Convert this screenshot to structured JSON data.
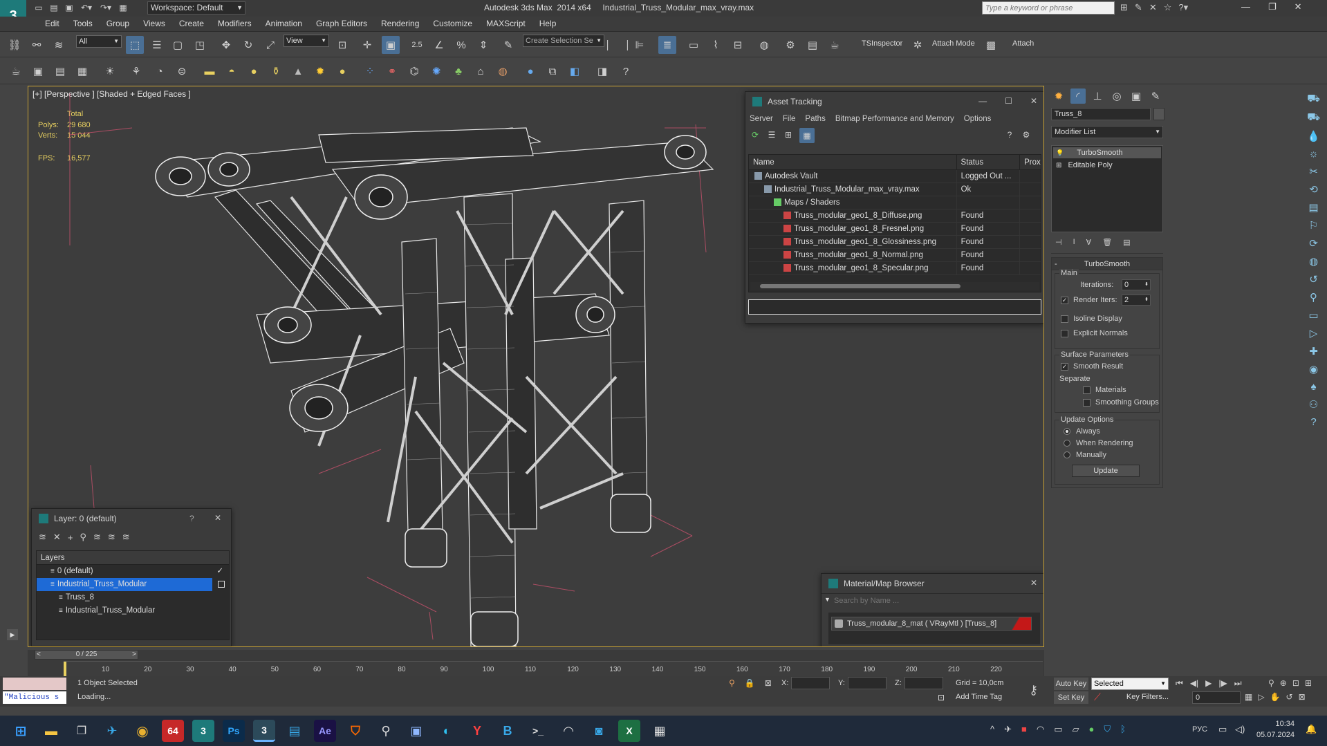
{
  "titlebar": {
    "quick_access": [
      "new-file-icon",
      "open-folder-icon",
      "save-icon",
      "undo-icon",
      "redo-icon",
      "project-icon"
    ],
    "workspace": "Workspace: Default",
    "app_title": "Autodesk 3ds Max  2014 x64     Industrial_Truss_Modular_max_vray.max",
    "search_placeholder": "Type a keyword or phrase"
  },
  "menu": [
    "Edit",
    "Tools",
    "Group",
    "Views",
    "Create",
    "Modifiers",
    "Animation",
    "Graph Editors",
    "Rendering",
    "Customize",
    "MAXScript",
    "Help"
  ],
  "toolbar1": {
    "filter_value": "All",
    "ref_coord": "View",
    "selection_set_placeholder": "Create Selection Se",
    "snap_label": "2.5",
    "ts_inspector": "TSInspector",
    "attach_mode": "Attach Mode",
    "attach": "Attach"
  },
  "viewport": {
    "label": "[+] [Perspective ] [Shaded + Edged Faces ]",
    "stats": {
      "total": "Total",
      "polys_label": "Polys:",
      "polys": "29 680",
      "verts_label": "Verts:",
      "verts": "15 044",
      "fps_label": "FPS:",
      "fps": "16,577"
    }
  },
  "asset_tracking": {
    "title": "Asset Tracking",
    "menu": [
      "Server",
      "File",
      "Paths",
      "Bitmap Performance and Memory",
      "Options"
    ],
    "columns": [
      "Name",
      "Status",
      "Prox"
    ],
    "rows": [
      {
        "name": "Autodesk Vault",
        "status": "Logged Out ...",
        "indent": 0,
        "icon": "vault-icon"
      },
      {
        "name": "Industrial_Truss_Modular_max_vray.max",
        "status": "Ok",
        "indent": 1,
        "icon": "max-file-icon"
      },
      {
        "name": "Maps / Shaders",
        "status": "",
        "indent": 2,
        "icon": "maps-folder-icon"
      },
      {
        "name": "Truss_modular_geo1_8_Diffuse.png",
        "status": "Found",
        "indent": 3,
        "icon": "png-icon"
      },
      {
        "name": "Truss_modular_geo1_8_Fresnel.png",
        "status": "Found",
        "indent": 3,
        "icon": "png-icon"
      },
      {
        "name": "Truss_modular_geo1_8_Glossiness.png",
        "status": "Found",
        "indent": 3,
        "icon": "png-icon"
      },
      {
        "name": "Truss_modular_geo1_8_Normal.png",
        "status": "Found",
        "indent": 3,
        "icon": "png-icon"
      },
      {
        "name": "Truss_modular_geo1_8_Specular.png",
        "status": "Found",
        "indent": 3,
        "icon": "png-icon"
      }
    ]
  },
  "layer_panel": {
    "title": "Layer: 0 (default)",
    "help": "?",
    "header": "Layers",
    "rows": [
      {
        "name": "0 (default)",
        "indent": 1,
        "selected": false,
        "check": true
      },
      {
        "name": "Industrial_Truss_Modular",
        "indent": 1,
        "selected": true,
        "check": false
      },
      {
        "name": "Truss_8",
        "indent": 2,
        "selected": false,
        "check": false
      },
      {
        "name": "Industrial_Truss_Modular",
        "indent": 2,
        "selected": false,
        "check": false
      }
    ]
  },
  "material_browser": {
    "title": "Material/Map Browser",
    "search_placeholder": "Search by Name ...",
    "item": "Truss_modular_8_mat  ( VRayMtl )  [Truss_8]"
  },
  "command_panel": {
    "object_name": "Truss_8",
    "modifier_list": "Modifier List",
    "stack": [
      "TurboSmooth",
      "Editable Poly"
    ],
    "rollout_title": "TurboSmooth",
    "main_label": "Main",
    "iterations_label": "Iterations:",
    "iterations": "0",
    "render_iters_label": "Render Iters:",
    "render_iters": "2",
    "isoline": "Isoline Display",
    "explicit": "Explicit Normals",
    "surface_params": "Surface Parameters",
    "smooth_result": "Smooth Result",
    "separate": "Separate",
    "materials": "Materials",
    "smoothing_groups": "Smoothing Groups",
    "update_options": "Update Options",
    "always": "Always",
    "when_rendering": "When Rendering",
    "manually": "Manually",
    "update_btn": "Update"
  },
  "timeline": {
    "frame": "0 / 225",
    "ticks": [
      "10",
      "20",
      "30",
      "40",
      "50",
      "60",
      "70",
      "80",
      "90",
      "100",
      "110",
      "120",
      "130",
      "140",
      "150",
      "160",
      "170",
      "180",
      "190",
      "200",
      "210",
      "220"
    ]
  },
  "status": {
    "selected": "1 Object Selected",
    "loading": "Loading...",
    "maxscript": "\"Malicious s",
    "x_label": "X:",
    "y_label": "Y:",
    "z_label": "Z:",
    "grid": "Grid = 10,0cm",
    "add_time_tag": "Add Time Tag",
    "auto_key": "Auto Key",
    "set_key": "Set Key",
    "selected_dropdown": "Selected",
    "key_filters": "Key Filters...",
    "frame_value": "0"
  },
  "taskbar": {
    "lang": "РУС",
    "time": "10:34",
    "date": "05.07.2024",
    "apps": [
      "windows-start-icon",
      "file-explorer-icon",
      "task-view-icon",
      "telegram-icon",
      "chrome-icon",
      "app-64-icon",
      "3dsmax-icon",
      "photoshop-icon",
      "3dsmax-active-icon",
      "notepad-icon",
      "after-effects-icon",
      "brave-icon",
      "search-app-icon",
      "save-app-icon",
      "edge-icon",
      "yandex-icon",
      "app-b-icon",
      "terminal-icon",
      "headphones-icon",
      "camera-icon",
      "excel-icon",
      "calculator-icon"
    ],
    "app_texts": {
      "app64": "64",
      "ps": "Ps",
      "ae": "Ae",
      "xl": "X"
    }
  },
  "colors": {
    "accent": "#4a6f95",
    "selection": "#1e6ad6",
    "viewport_border": "#c8a235",
    "stats": "#e8d060"
  }
}
